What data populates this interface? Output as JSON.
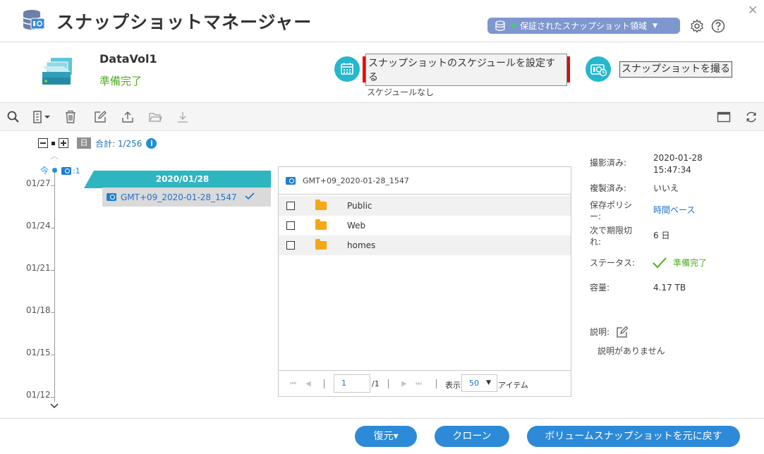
{
  "app": {
    "title": "スナップショットマネージャー",
    "pool_selector": "保証されたスナップショット領域",
    "icons": [
      "snapshot-manager-logo-icon",
      "database-icon",
      "gear-icon",
      "help-icon",
      "close-icon"
    ]
  },
  "volume": {
    "name": "DataVol1",
    "status": "準備完了",
    "schedule_button": "スナップショットのスケジュールを設定する",
    "schedule_note": "スケジュールなし",
    "take_button": "スナップショットを撮る"
  },
  "toolbar": {
    "icons": [
      "search-icon",
      "column-toggle-icon",
      "trash-icon",
      "edit-icon",
      "export-icon",
      "folder-open-icon",
      "download-icon",
      "panel-view-icon",
      "refresh-icon"
    ]
  },
  "timeline": {
    "day_label": "日",
    "total": "合計: 1/256",
    "now_label": "今",
    "now_count": ":1",
    "dates": [
      "01/27",
      "01/24",
      "01/21",
      "01/18",
      "01/15",
      "01/12"
    ],
    "group_date": "2020/01/28",
    "snapshot_name": "GMT+09_2020-01-28_1547"
  },
  "file_panel": {
    "header": "GMT+09_2020-01-28_1547",
    "files": [
      {
        "name": "Public"
      },
      {
        "name": "Web"
      },
      {
        "name": "homes"
      }
    ],
    "pager": {
      "page": "1",
      "of": "/1",
      "show_label": "表示",
      "per_page": "50",
      "items_label": "アイテム"
    }
  },
  "details": {
    "taken_label": "撮影済み:",
    "taken_date": "2020-01-28",
    "taken_time": "15:47:34",
    "replicated_label": "複製済み:",
    "replicated_value": "いいえ",
    "policy_label_1": "保存ポリシ",
    "policy_label_2": "ー:",
    "policy_value": "時間ベース",
    "expire_label_1": "次で期限切",
    "expire_label_2": "れ:",
    "expire_value": "6 日",
    "status_label": "ステータス:",
    "status_value": "準備完了",
    "capacity_label": "容量:",
    "capacity_value": "4.17 TB",
    "description_label": "説明:",
    "description_value": "説明がありません"
  },
  "footer": {
    "restore": "復元▾",
    "clone": "クローン",
    "revert": "ボリュームスナップショットを元に戻す"
  },
  "colors": {
    "accent": "#2c8ad8",
    "teal": "#2fb5c0",
    "ok": "#4cae1f",
    "highlight": "#ee0000",
    "pool": "#7f97cf"
  }
}
